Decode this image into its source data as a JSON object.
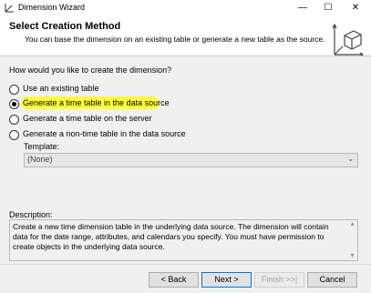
{
  "window": {
    "title": "Dimension Wizard",
    "minimize": "—",
    "maximize": "☐",
    "close": "✕"
  },
  "header": {
    "title": "Select Creation Method",
    "subtitle": "You can base the dimension on an existing table or generate a new table as the source."
  },
  "question": "How would you like to create the dimension?",
  "options": [
    {
      "label": "Use an existing table",
      "checked": false
    },
    {
      "label": "Generate a time table in the data source",
      "checked": true
    },
    {
      "label": "Generate a time table on the server",
      "checked": false
    },
    {
      "label": "Generate a non-time table in the data source",
      "checked": false
    }
  ],
  "template": {
    "label": "Template:",
    "value": "(None)"
  },
  "description": {
    "label": "Description:",
    "text": "Create a new time dimension table in the underlying data source. The dimension will contain data for the date range, attributes, and calendars you specify. You must have permission to create objects in the underlying data source."
  },
  "buttons": {
    "back": "< Back",
    "next": "Next >",
    "finish": "Finish >>|",
    "cancel": "Cancel"
  },
  "colors": {
    "highlight": "#ffff3a",
    "accent": "#0078d7"
  }
}
